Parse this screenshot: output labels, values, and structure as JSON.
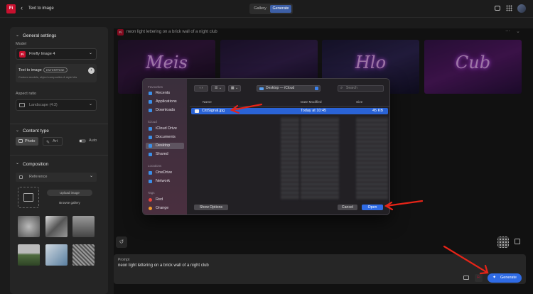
{
  "topbar": {
    "logo": "Fi",
    "back": "‹",
    "title": "Text to image",
    "tabs": [
      "Gallery",
      "Generate"
    ],
    "active_tab": "Generate",
    "icons": [
      "chat-icon",
      "grid-icon",
      "avatar"
    ]
  },
  "sidebar": {
    "general": {
      "title": "General settings",
      "model_label": "Model",
      "model_value": "Firefly Image 4",
      "t2i_label": "Text to image",
      "t2i_badge": "ENTERPRISE",
      "t2i_desc": "Custom models, object composites & style kits",
      "aspect_label": "Aspect ratio",
      "aspect_value": "Landscape (4:3)"
    },
    "content": {
      "title": "Content type",
      "photo": "Photo",
      "art": "Art",
      "auto": "Auto"
    },
    "composition": {
      "title": "Composition",
      "reference": "Reference",
      "upload": "Upload image",
      "browse": "Browse gallery"
    }
  },
  "main": {
    "prompt_echo": "neon light lettering on a brick wall of a night club",
    "tile_words": [
      "Meis",
      "",
      "Hlo",
      "Cub"
    ]
  },
  "dialog": {
    "location": "Desktop — iCloud",
    "search_placeholder": "Search",
    "sections": {
      "favourites": "Favourites",
      "icloud": "iCloud",
      "locations": "Locations",
      "tags": "Tags"
    },
    "favourites": [
      "Recents",
      "Applications",
      "Downloads"
    ],
    "icloud": [
      "iCloud Drive",
      "Documents",
      "Desktop",
      "Shared"
    ],
    "locations": [
      "OneDrive",
      "Network"
    ],
    "tags": [
      "Red",
      "Orange"
    ],
    "columns": {
      "name": "Name",
      "date": "Date Modified",
      "size": "Size"
    },
    "file": {
      "name": "CitiSignal.jpg",
      "date": "Today at 10:45",
      "size": "45 KB"
    },
    "show_options": "Show Options",
    "cancel": "Cancel",
    "open": "Open"
  },
  "bottom": {
    "prompt_label": "Prompt",
    "prompt_text": "neon light lettering on a brick wall of a night club",
    "generate": "Generate"
  },
  "colors": {
    "accent": "#2f6be5",
    "arrow": "#e62418",
    "brand": "#c8102e"
  }
}
